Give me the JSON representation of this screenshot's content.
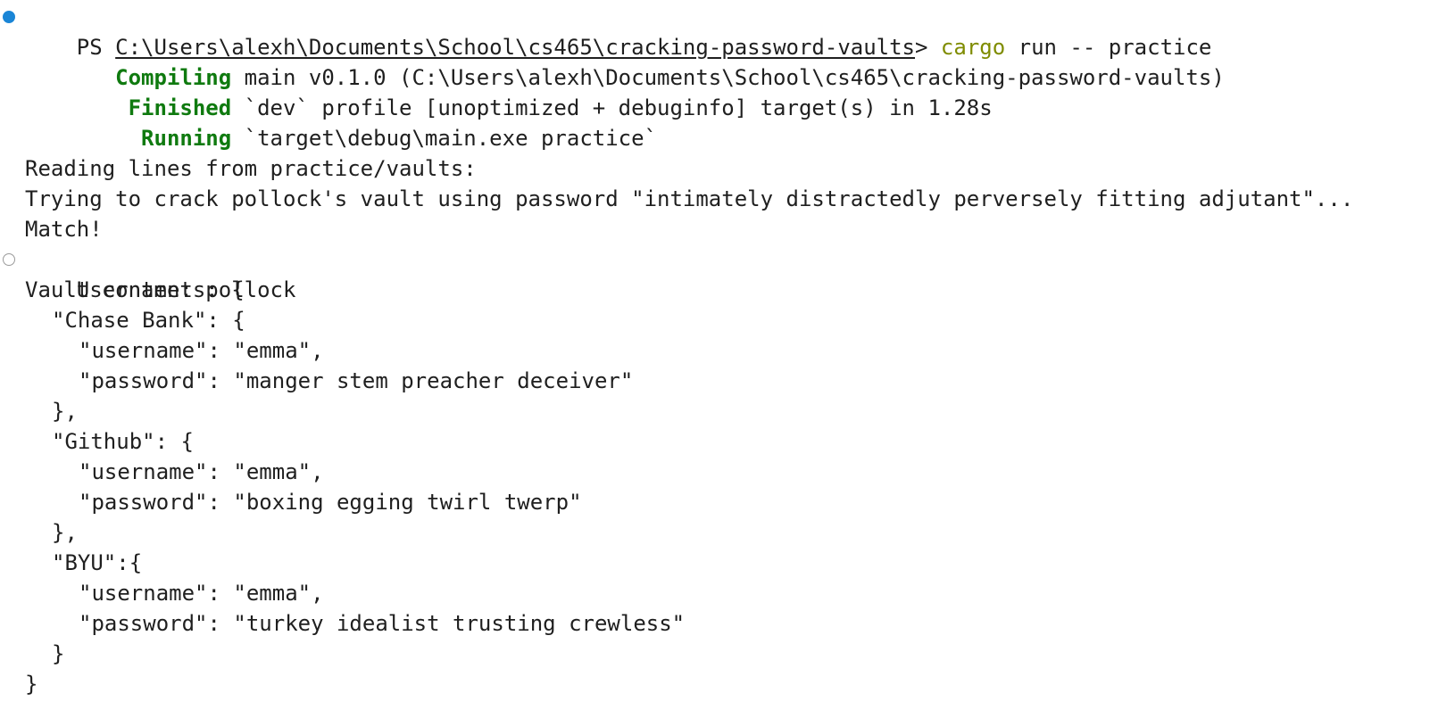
{
  "prompt": {
    "ps": "PS ",
    "path": "C:\\Users\\alexh\\Documents\\School\\cs465\\cracking-password-vaults",
    "gt": "> ",
    "cmd": "cargo",
    "args": " run -- practice"
  },
  "build": [
    {
      "status": "   Compiling",
      "text": " main v0.1.0 (C:\\Users\\alexh\\Documents\\School\\cs465\\cracking-password-vaults)"
    },
    {
      "status": "    Finished",
      "text": " `dev` profile [unoptimized + debuginfo] target(s) in 1.28s"
    },
    {
      "status": "     Running",
      "text": " `target\\debug\\main.exe practice`"
    }
  ],
  "output": {
    "reading": "Reading lines from practice/vaults:",
    "trying": "Trying to crack pollock's vault using password \"intimately distractedly perversely fitting adjutant\"...",
    "match": "Match!",
    "username": "Username: pollock",
    "vault_open": "Vault contents: {",
    "vault_close": "}"
  },
  "vault": [
    {
      "open": "\"Chase Bank\": {",
      "username": "\"username\": \"emma\",",
      "password": "\"password\": \"manger stem preacher deceiver\"",
      "close": "},"
    },
    {
      "open": "\"Github\": {",
      "username": "\"username\": \"emma\",",
      "password": "\"password\": \"boxing egging twirl twerp\"",
      "close": "},"
    },
    {
      "open": "\"BYU\":{",
      "username": "\"username\": \"emma\",",
      "password": "\"password\": \"turkey idealist trusting crewless\"",
      "close": "}"
    }
  ],
  "colors": {
    "cmd": "#7f8c00",
    "status": "#0f7a0f",
    "deco_filled": "#1a85d6",
    "deco_empty": "#9a9a9a"
  }
}
